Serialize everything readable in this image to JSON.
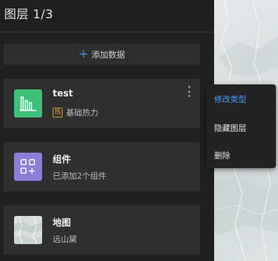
{
  "panel": {
    "title": "图层 1/3",
    "add_button_label": "添加数据"
  },
  "layers": [
    {
      "name": "test",
      "badge": "热",
      "subtitle": "基础热力",
      "thumb_color": "#3dbf7a"
    },
    {
      "name": "组件",
      "subtitle": "已添加2个组件",
      "thumb_color": "#8b7fd9"
    },
    {
      "name": "地图",
      "subtitle": "远山黛"
    }
  ],
  "context_menu": {
    "items": [
      "修改类型",
      "隐藏图层",
      "删除"
    ],
    "active_color": "#4c9bff"
  },
  "icons": {
    "add": "plus-icon",
    "heat_layer": "bar-chart-icon",
    "component_layer": "grid-add-icon",
    "map_layer": "map-thumbnail",
    "more": "kebab-menu-icon"
  }
}
